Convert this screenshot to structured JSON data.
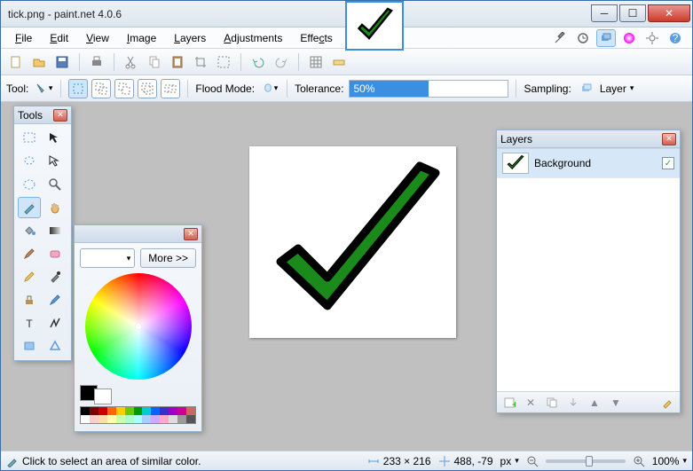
{
  "window": {
    "title": "tick.png - paint.net 4.0.6"
  },
  "menu": {
    "file": "File",
    "edit": "Edit",
    "view": "View",
    "image": "Image",
    "layers": "Layers",
    "adjustments": "Adjustments",
    "effects": "Effects"
  },
  "toolbar2": {
    "tool_label": "Tool:",
    "flood_mode_label": "Flood Mode:",
    "tolerance_label": "Tolerance:",
    "tolerance_value": "50%",
    "sampling_label": "Sampling:",
    "sampling_value": "Layer"
  },
  "panels": {
    "tools_title": "Tools",
    "colors_more": "More >>",
    "layers_title": "Layers",
    "layer_name": "Background"
  },
  "status": {
    "hint": "Click to select an area of similar color.",
    "dims": "233 × 216",
    "coords": "488, -79",
    "unit": "px",
    "zoom": "100%"
  },
  "palette_row1": [
    "#000",
    "#7f0000",
    "#cc0000",
    "#ff6600",
    "#ffcc00",
    "#66cc00",
    "#009900",
    "#00cccc",
    "#0066ff",
    "#3333cc",
    "#9900cc",
    "#cc0099",
    "#cc6666"
  ],
  "palette_row2": [
    "#fff",
    "#ffcccc",
    "#ffddaa",
    "#ffffaa",
    "#ccffaa",
    "#aaffcc",
    "#aaffff",
    "#aaccff",
    "#ccaaff",
    "#ffaacc",
    "#dddddd",
    "#999999",
    "#555555"
  ]
}
